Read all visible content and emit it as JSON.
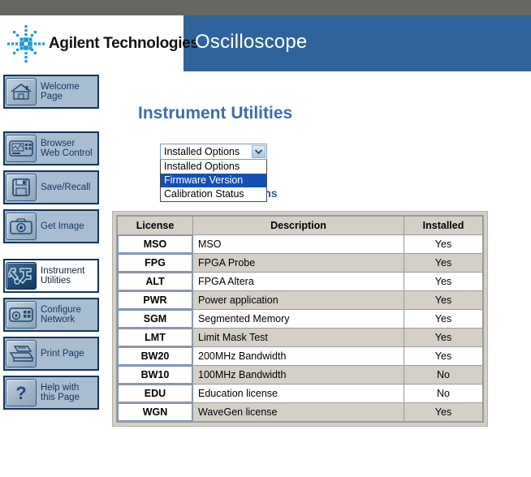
{
  "header": {
    "brand": "Agilent Technologies",
    "app_title": "Oscilloscope",
    "logo_icon": "agilent-starburst-logo",
    "brand_color": "#2f6399",
    "strip_color": "#666663"
  },
  "sidebar": {
    "items": [
      {
        "label_line1": "Welcome",
        "label_line2": "Page",
        "icon": "home-icon",
        "active": false
      },
      {
        "label_line1": "Browser",
        "label_line2": "Web Control",
        "icon": "monitor-icon",
        "active": false
      },
      {
        "label_line1": "Save/Recall",
        "label_line2": "",
        "icon": "floppy-disk-icon",
        "active": false
      },
      {
        "label_line1": "Get Image",
        "label_line2": "",
        "icon": "camera-icon",
        "active": false
      },
      {
        "label_line1": "Instrument",
        "label_line2": "Utilities",
        "icon": "wrench-tools-icon",
        "active": true
      },
      {
        "label_line1": "Configure",
        "label_line2": "Network",
        "icon": "network-icon",
        "active": false
      },
      {
        "label_line1": "Print Page",
        "label_line2": "",
        "icon": "printer-icon",
        "active": false
      },
      {
        "label_line1": "Help with",
        "label_line2": "this Page",
        "icon": "question-mark-icon",
        "active": false
      }
    ]
  },
  "main": {
    "page_title": "Instrument Utilities",
    "section_heading": "Installed Options",
    "selector": {
      "value": "Installed Options",
      "arrow_icon": "chevron-down-icon",
      "options": [
        {
          "label": "Installed Options",
          "highlighted": false
        },
        {
          "label": "Firmware Version",
          "highlighted": true
        },
        {
          "label": "Calibration Status",
          "highlighted": false
        }
      ]
    },
    "table": {
      "columns": [
        "License",
        "Description",
        "Installed"
      ],
      "rows": [
        {
          "license": "MSO",
          "description": "MSO",
          "installed": "Yes"
        },
        {
          "license": "FPG",
          "description": "FPGA Probe",
          "installed": "Yes"
        },
        {
          "license": "ALT",
          "description": "FPGA Altera",
          "installed": "Yes"
        },
        {
          "license": "PWR",
          "description": "Power application",
          "installed": "Yes"
        },
        {
          "license": "SGM",
          "description": "Segmented Memory",
          "installed": "Yes"
        },
        {
          "license": "LMT",
          "description": "Limit Mask Test",
          "installed": "Yes"
        },
        {
          "license": "BW20",
          "description": "200MHz Bandwidth",
          "installed": "Yes"
        },
        {
          "license": "BW10",
          "description": "100MHz Bandwidth",
          "installed": "No"
        },
        {
          "license": "EDU",
          "description": "Education license",
          "installed": "No"
        },
        {
          "license": "WGN",
          "description": "WaveGen license",
          "installed": "Yes"
        }
      ]
    }
  }
}
